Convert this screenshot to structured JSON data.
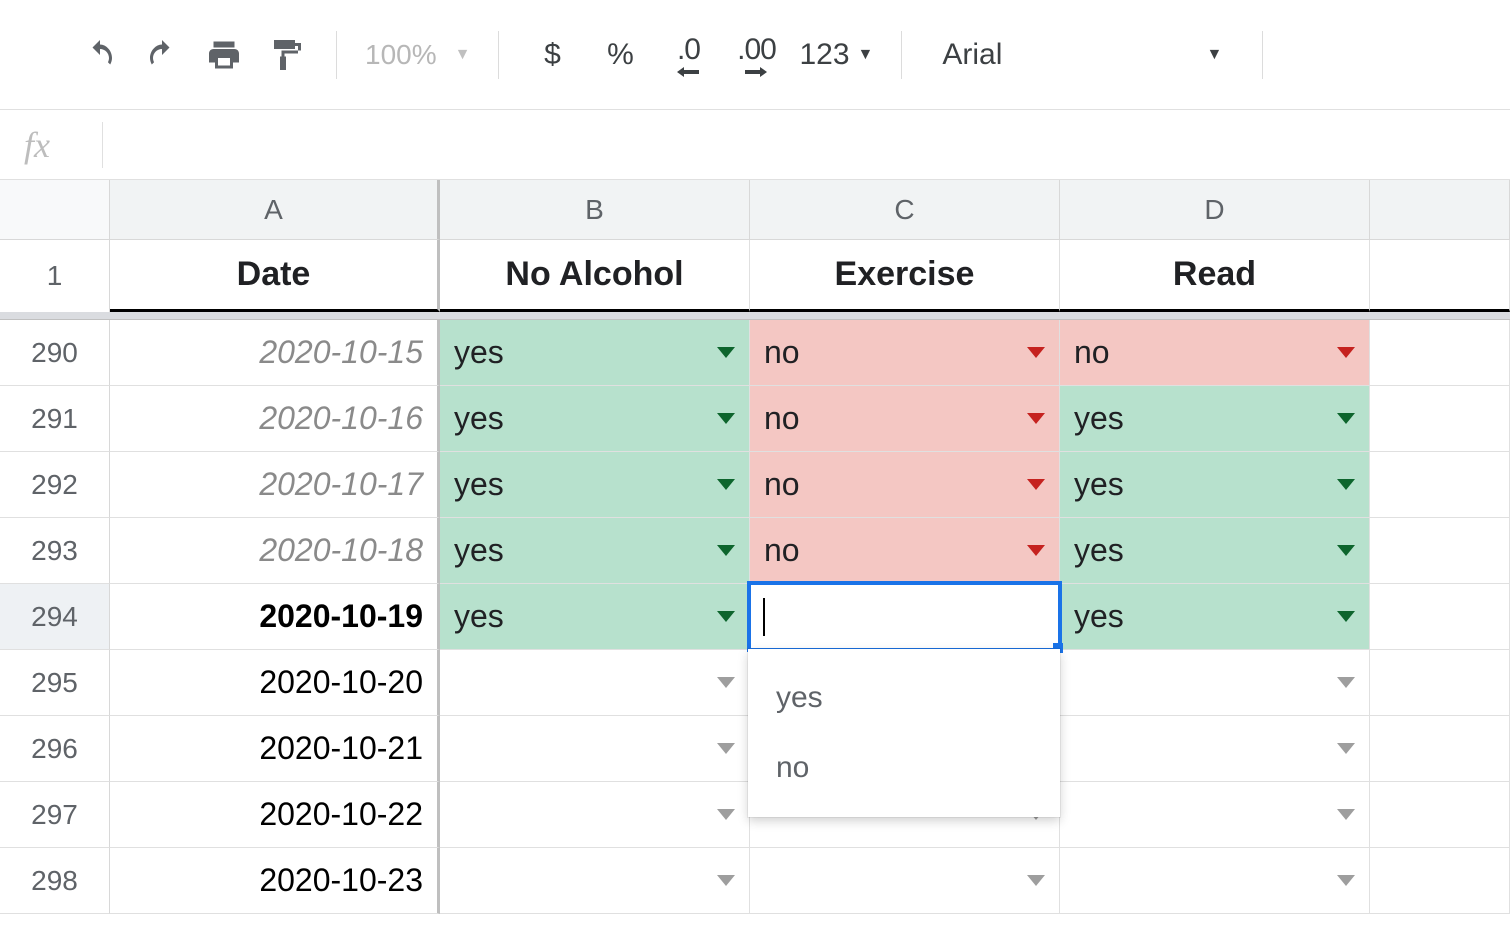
{
  "toolbar": {
    "zoom": "100%",
    "currency_label": "$",
    "percent_label": "%",
    "dec_decrease": ".0",
    "dec_increase": ".00",
    "more_formats": "123",
    "font_name": "Arial"
  },
  "formula_bar": {
    "fx": "fx",
    "value": ""
  },
  "columns": [
    "A",
    "B",
    "C",
    "D"
  ],
  "header_row": {
    "row": "1",
    "A": "Date",
    "B": "No Alcohol",
    "C": "Exercise",
    "D": "Read"
  },
  "rows": [
    {
      "n": "290",
      "date": "2020-10-15",
      "state": "past",
      "B": "yes",
      "C": "no",
      "D": "no"
    },
    {
      "n": "291",
      "date": "2020-10-16",
      "state": "past",
      "B": "yes",
      "C": "no",
      "D": "yes"
    },
    {
      "n": "292",
      "date": "2020-10-17",
      "state": "past",
      "B": "yes",
      "C": "no",
      "D": "yes"
    },
    {
      "n": "293",
      "date": "2020-10-18",
      "state": "past",
      "B": "yes",
      "C": "no",
      "D": "yes"
    },
    {
      "n": "294",
      "date": "2020-10-19",
      "state": "today",
      "B": "yes",
      "C": "",
      "D": "yes"
    },
    {
      "n": "295",
      "date": "2020-10-20",
      "state": "future",
      "B": "",
      "C": "",
      "D": ""
    },
    {
      "n": "296",
      "date": "2020-10-21",
      "state": "future",
      "B": "",
      "C": "",
      "D": ""
    },
    {
      "n": "297",
      "date": "2020-10-22",
      "state": "future",
      "B": "",
      "C": "",
      "D": ""
    },
    {
      "n": "298",
      "date": "2020-10-23",
      "state": "future",
      "B": "",
      "C": "",
      "D": ""
    }
  ],
  "active_cell": {
    "row": "294",
    "col": "C"
  },
  "dropdown_options": [
    "yes",
    "no"
  ],
  "colors": {
    "yes_bg": "#b7e1cd",
    "no_bg": "#f4c7c3",
    "selection_blue": "#1a73e8"
  }
}
